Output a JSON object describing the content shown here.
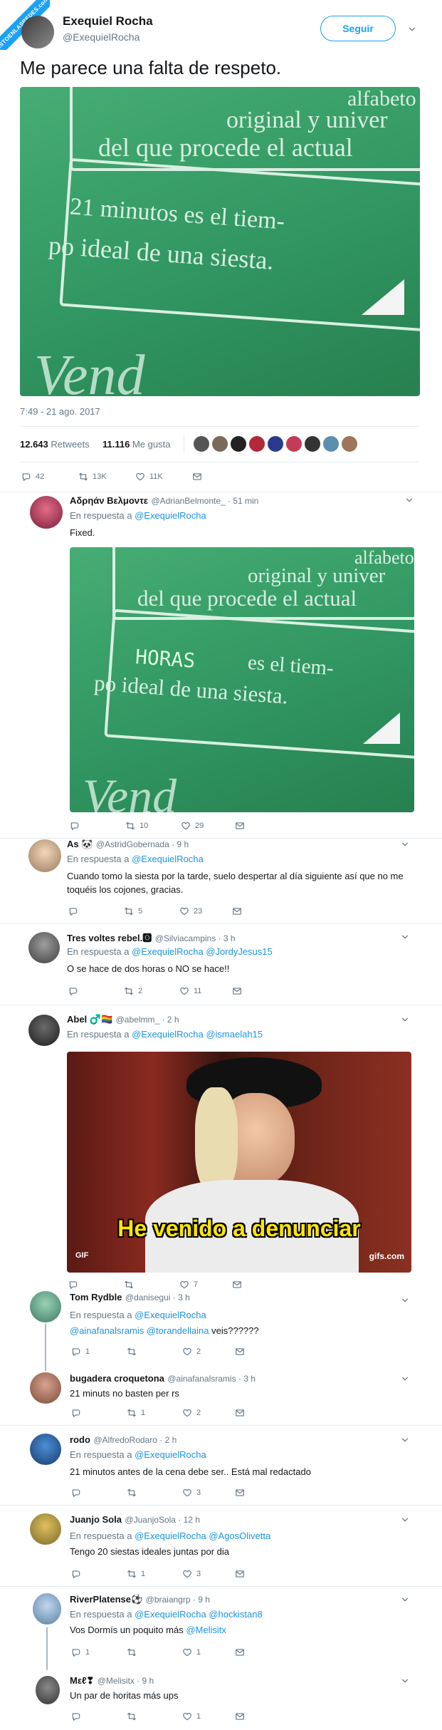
{
  "ribbon_text": "VISTOENLASREDES.com",
  "tweet": {
    "author_name": "Exequiel Rocha",
    "author_handle": "@ExequielRocha",
    "follow_label": "Seguir",
    "text": "Me parece una falta de respeto.",
    "image_lines": [
      "alfabeto",
      "original y univer",
      "del que procede el actual",
      "21 minutos es el tiem-",
      "po ideal de una siesta.",
      "Vend"
    ],
    "timestamp": "7:49 - 21 ago. 2017",
    "retweets_count": "12.643",
    "retweets_label": "Retweets",
    "likes_count": "11.116",
    "likes_label": "Me gusta",
    "actions": {
      "replies": "42",
      "retweets": "13K",
      "likes": "11K"
    }
  },
  "replies": [
    {
      "name": "Αδρηάν Βελμοντε",
      "handle": "@AdrianBelmonte_ · 51 min",
      "in_reply_prefix": "En respuesta a",
      "in_reply_to": "@ExequielRocha",
      "text": "Fixed.",
      "image_word": "HORAS",
      "actions": {
        "replies": "",
        "retweets": "10",
        "likes": "29"
      }
    },
    {
      "name": "As 🐼",
      "handle": "@AstridGobernada · 9 h",
      "in_reply_prefix": "En respuesta a",
      "in_reply_to": "@ExequielRocha",
      "text": "Cuando tomo la siesta por la tarde, suelo despertar al día siguiente así que no me toquéis los cojones, gracias.",
      "actions": {
        "replies": "",
        "retweets": "5",
        "likes": "23"
      }
    },
    {
      "name": "Tres voltes rebel.🅾",
      "handle": "@Silviacampins · 3 h",
      "in_reply_prefix": "En respuesta a",
      "in_reply_to": "@ExequielRocha @JordyJesus15",
      "text": "O se hace de dos horas o NO se hace!!",
      "actions": {
        "replies": "",
        "retweets": "2",
        "likes": "11"
      }
    },
    {
      "name": "Abel ♂️🏳️‍🌈",
      "handle": "@abelmm_ · 2 h",
      "in_reply_prefix": "En respuesta a",
      "in_reply_to": "@ExequielRocha @ismaelah15",
      "gif_caption": "He venido a denunciar",
      "gif_badge": "GIF",
      "gif_source": "gifs.com",
      "actions": {
        "replies": "",
        "retweets": "",
        "likes": "7"
      }
    },
    {
      "name": "Tom Rydble",
      "handle": "@danisegui · 3 h",
      "in_reply_prefix": "En respuesta a",
      "in_reply_to": "@ExequielRocha",
      "text_mentions": "@ainafanalsramis @torandellaina",
      "text": "veis??????",
      "actions": {
        "replies": "1",
        "retweets": "",
        "likes": "2"
      }
    },
    {
      "name": "bugadera croquetona",
      "handle": "@ainafanalsramis · 3 h",
      "text": "21 minuts no basten per rs",
      "actions": {
        "replies": "",
        "retweets": "1",
        "likes": "2"
      }
    },
    {
      "name": "rodo",
      "handle": "@AlfredoRodaro · 2 h",
      "in_reply_prefix": "En respuesta a",
      "in_reply_to": "@ExequielRocha",
      "text": "21 minutos antes de la cena debe ser.. Está mal redactado",
      "actions": {
        "replies": "",
        "retweets": "",
        "likes": "3"
      }
    },
    {
      "name": "Juanjo Sola",
      "handle": "@JuanjoSola · 12 h",
      "in_reply_prefix": "En respuesta a",
      "in_reply_to": "@ExequielRocha @AgosOlivetta",
      "text": "Tengo 20 siestas ideales juntas por dia",
      "actions": {
        "replies": "",
        "retweets": "1",
        "likes": "3"
      }
    },
    {
      "name": "RiverPlatense⚽",
      "handle": "@braiangrp · 9 h",
      "in_reply_prefix": "En respuesta a",
      "in_reply_to": "@ExequielRocha @hockistan8",
      "text_prefix": "Vos Dormís un poquito más",
      "text_mention": "@Melisitx",
      "actions": {
        "replies": "1",
        "retweets": "",
        "likes": "1"
      }
    },
    {
      "name": "Mεℓ❣",
      "handle": "@Melisitx · 9 h",
      "text": "Un par de horitas más ups",
      "actions": {
        "replies": "",
        "retweets": "",
        "likes": "1"
      }
    }
  ],
  "colors": {
    "accent": "#1da1f2",
    "link": "#1b95e0",
    "muted": "#657786",
    "image_green": "#3aa26a"
  }
}
